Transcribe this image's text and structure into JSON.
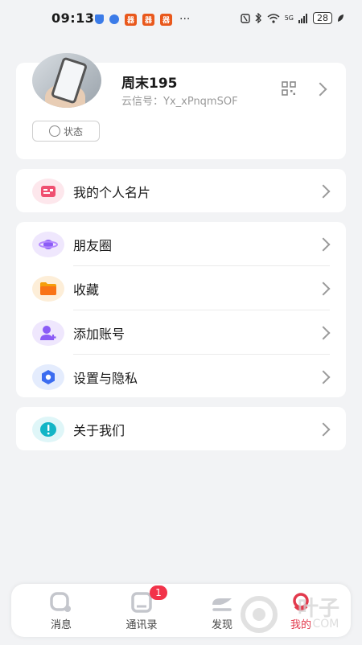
{
  "status_bar": {
    "time": "09:13",
    "app_badge_glyph": "器",
    "more_dots": "···",
    "network": "5G",
    "battery": "28"
  },
  "profile": {
    "nickname": "周末195",
    "signal_id": "云信号：Yx_xPnqmSOF",
    "status_label": "状态"
  },
  "namecard": {
    "label": "我的个人名片"
  },
  "menu": [
    {
      "label": "朋友圈",
      "icon": "planet-icon"
    },
    {
      "label": "收藏",
      "icon": "folder-icon"
    },
    {
      "label": "添加账号",
      "icon": "add-user-icon"
    },
    {
      "label": "设置与隐私",
      "icon": "settings-icon"
    }
  ],
  "about": {
    "label": "关于我们"
  },
  "tabbar": {
    "tabs": [
      {
        "label": "消息"
      },
      {
        "label": "通讯录",
        "badge": "1"
      },
      {
        "label": "发现"
      },
      {
        "label": "我的"
      }
    ]
  },
  "watermark": {
    "text": "叶子",
    "domain": ".COM"
  },
  "colors": {
    "accent": "#e23a4d",
    "namecard_icon": "#ef4f70",
    "planet_icon": "#8b5cf6",
    "folder_icon": "#f59e0b",
    "add_user_icon": "#8b5cf6",
    "settings_icon": "#3b6cf0",
    "about_icon": "#12b5c6"
  }
}
